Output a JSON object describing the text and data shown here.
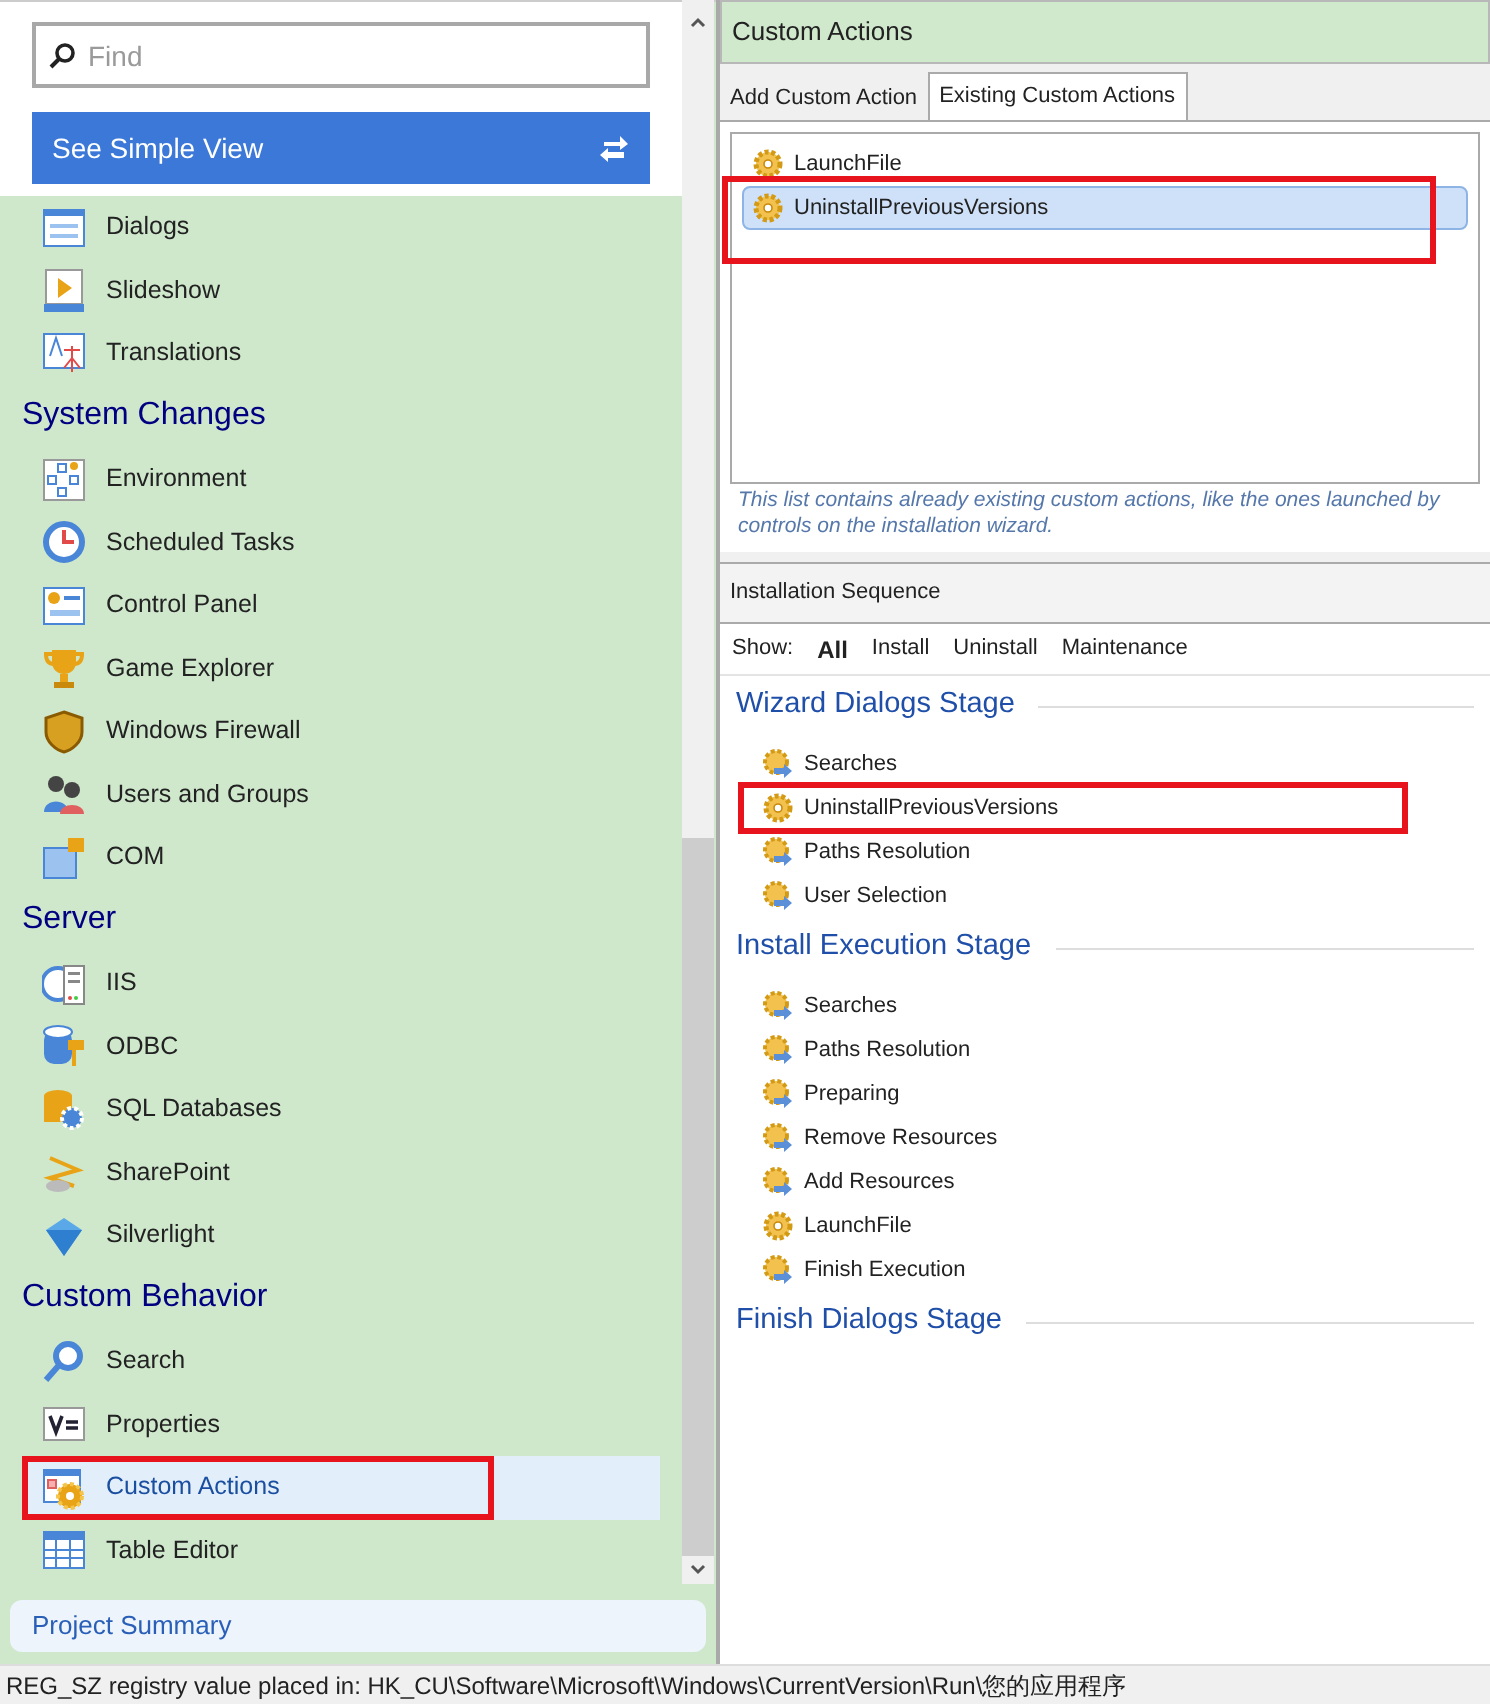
{
  "search": {
    "placeholder": "Find"
  },
  "view_button": {
    "label": "See Simple View"
  },
  "sidebar": {
    "groups": [
      {
        "items": [
          {
            "label": "Dialogs",
            "selected": false,
            "highlighted": false
          },
          {
            "label": "Slideshow",
            "selected": false,
            "highlighted": false
          },
          {
            "label": "Translations",
            "selected": false,
            "highlighted": false
          }
        ]
      },
      {
        "title": "System Changes",
        "items": [
          {
            "label": "Environment",
            "selected": false,
            "highlighted": false
          },
          {
            "label": "Scheduled Tasks",
            "selected": false,
            "highlighted": false
          },
          {
            "label": "Control Panel",
            "selected": false,
            "highlighted": false
          },
          {
            "label": "Game Explorer",
            "selected": false,
            "highlighted": false
          },
          {
            "label": "Windows Firewall",
            "selected": false,
            "highlighted": false
          },
          {
            "label": "Users and Groups",
            "selected": false,
            "highlighted": false
          },
          {
            "label": "COM",
            "selected": false,
            "highlighted": false
          }
        ]
      },
      {
        "title": "Server",
        "items": [
          {
            "label": "IIS",
            "selected": false,
            "highlighted": false
          },
          {
            "label": "ODBC",
            "selected": false,
            "highlighted": false
          },
          {
            "label": "SQL Databases",
            "selected": false,
            "highlighted": false
          },
          {
            "label": "SharePoint",
            "selected": false,
            "highlighted": false
          },
          {
            "label": "Silverlight",
            "selected": false,
            "highlighted": false
          }
        ]
      },
      {
        "title": "Custom Behavior",
        "items": [
          {
            "label": "Search",
            "selected": false,
            "highlighted": false
          },
          {
            "label": "Properties",
            "selected": false,
            "highlighted": false
          },
          {
            "label": "Custom Actions",
            "selected": true,
            "highlighted": true
          },
          {
            "label": "Table Editor",
            "selected": false,
            "highlighted": false
          }
        ]
      }
    ]
  },
  "project_summary": "Project Summary",
  "panel": {
    "title": "Custom Actions",
    "tabs": [
      {
        "label": "Add Custom Action",
        "selected": false
      },
      {
        "label": "Existing Custom Actions",
        "selected": true
      }
    ],
    "actions": [
      {
        "label": "LaunchFile",
        "selected": false,
        "highlighted": false
      },
      {
        "label": "UninstallPreviousVersions",
        "selected": true,
        "highlighted": true
      }
    ],
    "note": "This list contains already existing custom actions, like the ones launched by controls on the installation wizard."
  },
  "sequence": {
    "title": "Installation Sequence",
    "show_label": "Show:",
    "filters": [
      {
        "label": "All",
        "selected": true
      },
      {
        "label": "Install",
        "selected": false
      },
      {
        "label": "Uninstall",
        "selected": false
      },
      {
        "label": "Maintenance",
        "selected": false
      }
    ],
    "stages": [
      {
        "title": "Wizard Dialogs Stage",
        "steps": [
          {
            "label": "Searches",
            "kind": "step",
            "highlighted": false
          },
          {
            "label": "UninstallPreviousVersions",
            "kind": "action",
            "highlighted": true
          },
          {
            "label": "Paths Resolution",
            "kind": "step",
            "highlighted": false
          },
          {
            "label": "User Selection",
            "kind": "step",
            "highlighted": false
          }
        ]
      },
      {
        "title": "Install Execution Stage",
        "steps": [
          {
            "label": "Searches",
            "kind": "step",
            "highlighted": false
          },
          {
            "label": "Paths Resolution",
            "kind": "step",
            "highlighted": false
          },
          {
            "label": "Preparing",
            "kind": "step",
            "highlighted": false
          },
          {
            "label": "Remove Resources",
            "kind": "step",
            "highlighted": false
          },
          {
            "label": "Add Resources",
            "kind": "step",
            "highlighted": false
          },
          {
            "label": "LaunchFile",
            "kind": "action",
            "highlighted": false
          },
          {
            "label": "Finish Execution",
            "kind": "step",
            "highlighted": false
          }
        ]
      },
      {
        "title": "Finish Dialogs Stage"
      }
    ]
  },
  "status_bar": "REG_SZ registry value placed in: HK_CU\\Software\\Microsoft\\Windows\\CurrentVersion\\Run\\您的应用程序"
}
